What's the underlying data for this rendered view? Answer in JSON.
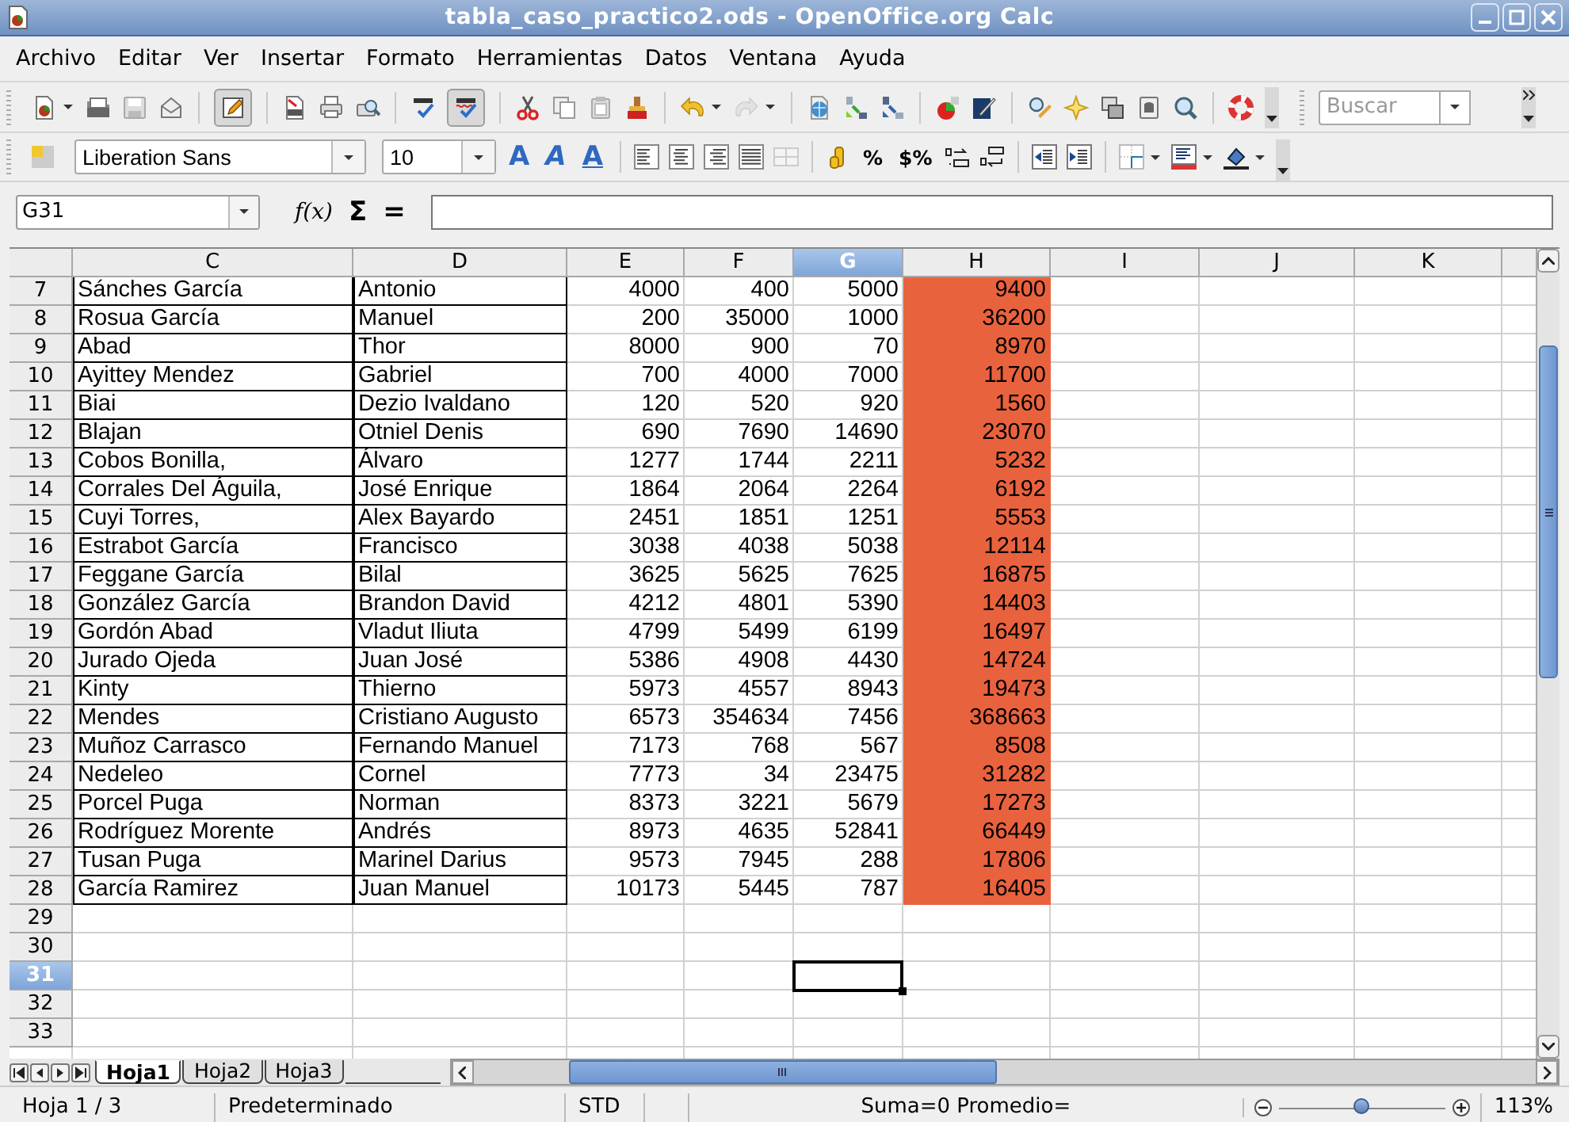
{
  "window": {
    "title": "tabla_caso_practico2.ods - OpenOffice.org Calc"
  },
  "menu": [
    "Archivo",
    "Editar",
    "Ver",
    "Insertar",
    "Formato",
    "Herramientas",
    "Datos",
    "Ventana",
    "Ayuda"
  ],
  "toolbar": {
    "edit_mode_on": true,
    "auto_spellcheck_on": true,
    "search_placeholder": "Buscar"
  },
  "formatting": {
    "font_name": "Liberation Sans",
    "font_size": "10",
    "effects": [
      "A",
      "A",
      "A"
    ],
    "number_formats": [
      "%",
      "$%"
    ]
  },
  "formula_bar": {
    "cell_ref": "G31",
    "buttons": [
      "f(x)",
      "Σ",
      "="
    ]
  },
  "columns": [
    {
      "label": "C",
      "selected": false
    },
    {
      "label": "D",
      "selected": false
    },
    {
      "label": "E",
      "selected": false
    },
    {
      "label": "F",
      "selected": false
    },
    {
      "label": "G",
      "selected": true
    },
    {
      "label": "H",
      "selected": false,
      "color": "#e9623e"
    },
    {
      "label": "I",
      "selected": false
    },
    {
      "label": "J",
      "selected": false
    },
    {
      "label": "K",
      "selected": false
    }
  ],
  "rows": [
    {
      "number": "7",
      "selected": false,
      "cells": [
        "Sánches García",
        "Antonio",
        "4000",
        "400",
        "5000",
        "9400"
      ]
    },
    {
      "number": "8",
      "selected": false,
      "cells": [
        "Rosua García",
        "Manuel",
        "200",
        "35000",
        "1000",
        "36200"
      ]
    },
    {
      "number": "9",
      "selected": false,
      "cells": [
        "Abad",
        "Thor",
        "8000",
        "900",
        "70",
        "8970"
      ]
    },
    {
      "number": "10",
      "selected": false,
      "cells": [
        "Ayittey Mendez",
        "Gabriel",
        "700",
        "4000",
        "7000",
        "11700"
      ]
    },
    {
      "number": "11",
      "selected": false,
      "cells": [
        "Biai",
        "Dezio Ivaldano",
        "120",
        "520",
        "920",
        "1560"
      ]
    },
    {
      "number": "12",
      "selected": false,
      "cells": [
        "Blajan",
        "Otniel Denis",
        "690",
        "7690",
        "14690",
        "23070"
      ]
    },
    {
      "number": "13",
      "selected": false,
      "cells": [
        "Cobos Bonilla,",
        "Álvaro",
        "1277",
        "1744",
        "2211",
        "5232"
      ]
    },
    {
      "number": "14",
      "selected": false,
      "cells": [
        "Corrales Del Águila,",
        "José Enrique",
        "1864",
        "2064",
        "2264",
        "6192"
      ]
    },
    {
      "number": "15",
      "selected": false,
      "cells": [
        "Cuyi Torres,",
        "Alex Bayardo",
        "2451",
        "1851",
        "1251",
        "5553"
      ]
    },
    {
      "number": "16",
      "selected": false,
      "cells": [
        "Estrabot García",
        "Francisco",
        "3038",
        "4038",
        "5038",
        "12114"
      ]
    },
    {
      "number": "17",
      "selected": false,
      "cells": [
        "Feggane García",
        "Bilal",
        "3625",
        "5625",
        "7625",
        "16875"
      ]
    },
    {
      "number": "18",
      "selected": false,
      "cells": [
        "González García",
        "Brandon David",
        "4212",
        "4801",
        "5390",
        "14403"
      ]
    },
    {
      "number": "19",
      "selected": false,
      "cells": [
        "Gordón Abad",
        "Vladut Iliuta",
        "4799",
        "5499",
        "6199",
        "16497"
      ]
    },
    {
      "number": "20",
      "selected": false,
      "cells": [
        "Jurado Ojeda",
        "Juan José",
        "5386",
        "4908",
        "4430",
        "14724"
      ]
    },
    {
      "number": "21",
      "selected": false,
      "cells": [
        "Kinty",
        "Thierno",
        "5973",
        "4557",
        "8943",
        "19473"
      ]
    },
    {
      "number": "22",
      "selected": false,
      "cells": [
        "Mendes",
        "Cristiano Augusto",
        "6573",
        "354634",
        "7456",
        "368663"
      ]
    },
    {
      "number": "23",
      "selected": false,
      "cells": [
        "Muñoz Carrasco",
        "Fernando Manuel",
        "7173",
        "768",
        "567",
        "8508"
      ]
    },
    {
      "number": "24",
      "selected": false,
      "cells": [
        "Nedeleo",
        "Cornel",
        "7773",
        "34",
        "23475",
        "31282"
      ]
    },
    {
      "number": "25",
      "selected": false,
      "cells": [
        "Porcel Puga",
        "Norman",
        "8373",
        "3221",
        "5679",
        "17273"
      ]
    },
    {
      "number": "26",
      "selected": false,
      "cells": [
        "Rodríguez Morente",
        "Andrés",
        "8973",
        "4635",
        "52841",
        "66449"
      ]
    },
    {
      "number": "27",
      "selected": false,
      "cells": [
        "Tusan Puga",
        "Marinel Darius",
        "9573",
        "7945",
        "288",
        "17806"
      ]
    },
    {
      "number": "28",
      "selected": false,
      "cells": [
        "García Ramirez",
        "Juan Manuel",
        "10173",
        "5445",
        "787",
        "16405"
      ]
    },
    {
      "number": "29",
      "selected": false
    },
    {
      "number": "30",
      "selected": false
    },
    {
      "number": "31",
      "selected": true
    },
    {
      "number": "32",
      "selected": false
    },
    {
      "number": "33",
      "selected": false
    }
  ],
  "sheet_tabs": [
    {
      "label": "Hoja1",
      "selected": true
    },
    {
      "label": "Hoja2",
      "selected": false
    },
    {
      "label": "Hoja3",
      "selected": false
    }
  ],
  "status_bar": {
    "sheet": "Hoja 1 / 3",
    "style": "Predeterminado",
    "mode": "STD",
    "summary": "Suma=0 Promedio=",
    "zoom_slider": {
      "level": 0.5
    },
    "zoom": "113%"
  }
}
